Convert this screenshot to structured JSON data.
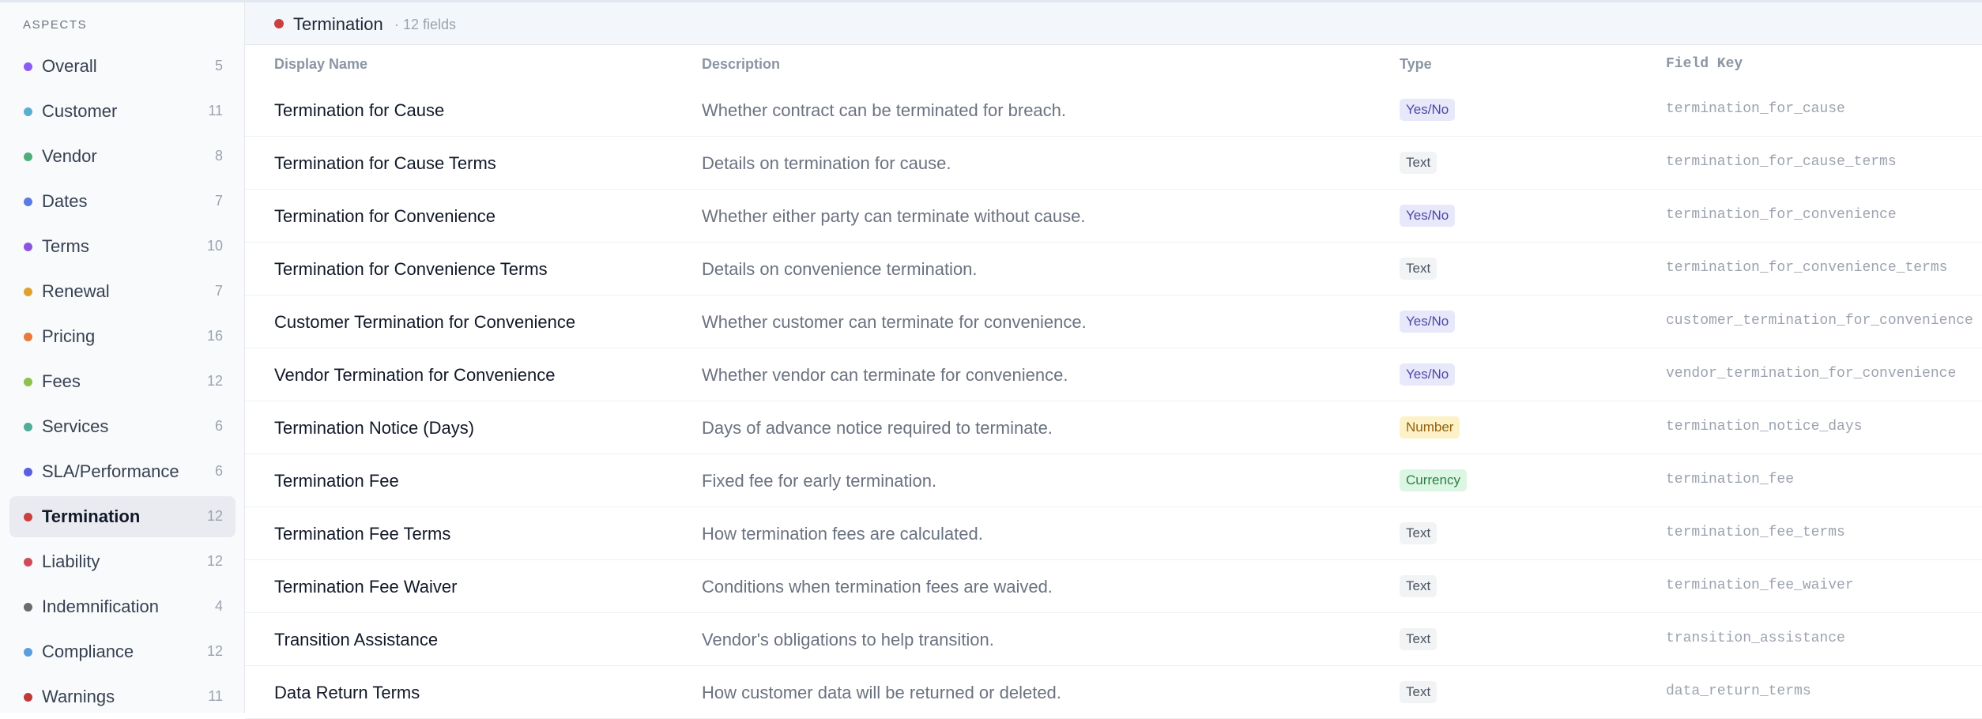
{
  "sidebar": {
    "title": "ASPECTS",
    "items": [
      {
        "label": "Overall",
        "count": "5",
        "color": "#8b5cf6"
      },
      {
        "label": "Customer",
        "count": "11",
        "color": "#5aaed0"
      },
      {
        "label": "Vendor",
        "count": "8",
        "color": "#4fae7a"
      },
      {
        "label": "Dates",
        "count": "7",
        "color": "#5b7be0"
      },
      {
        "label": "Terms",
        "count": "10",
        "color": "#8b55e0"
      },
      {
        "label": "Renewal",
        "count": "7",
        "color": "#e0a030"
      },
      {
        "label": "Pricing",
        "count": "16",
        "color": "#e8793a"
      },
      {
        "label": "Fees",
        "count": "12",
        "color": "#8cc24a"
      },
      {
        "label": "Services",
        "count": "6",
        "color": "#4fae95"
      },
      {
        "label": "SLA/Performance",
        "count": "6",
        "color": "#5a5fe0"
      },
      {
        "label": "Termination",
        "count": "12",
        "color": "#cc3f3f",
        "active": true
      },
      {
        "label": "Liability",
        "count": "12",
        "color": "#d04a5a"
      },
      {
        "label": "Indemnification",
        "count": "4",
        "color": "#6b6b6b"
      },
      {
        "label": "Compliance",
        "count": "12",
        "color": "#5a9ee0"
      },
      {
        "label": "Warnings",
        "count": "11",
        "color": "#c03a3a"
      }
    ]
  },
  "section": {
    "title": "Termination",
    "subtitle": "· 12 fields",
    "color": "#cc3f3f"
  },
  "table": {
    "headers": {
      "display_name": "Display Name",
      "description": "Description",
      "type": "Type",
      "field_key": "Field Key"
    },
    "rows": [
      {
        "name": "Termination for Cause",
        "desc": "Whether contract can be terminated for breach.",
        "type": "Yes/No",
        "kind": "yesno",
        "key": "termination_for_cause"
      },
      {
        "name": "Termination for Cause Terms",
        "desc": "Details on termination for cause.",
        "type": "Text",
        "kind": "text",
        "key": "termination_for_cause_terms"
      },
      {
        "name": "Termination for Convenience",
        "desc": "Whether either party can terminate without cause.",
        "type": "Yes/No",
        "kind": "yesno",
        "key": "termination_for_convenience"
      },
      {
        "name": "Termination for Convenience Terms",
        "desc": "Details on convenience termination.",
        "type": "Text",
        "kind": "text",
        "key": "termination_for_convenience_terms"
      },
      {
        "name": "Customer Termination for Convenience",
        "desc": "Whether customer can terminate for convenience.",
        "type": "Yes/No",
        "kind": "yesno",
        "key": "customer_termination_for_convenience"
      },
      {
        "name": "Vendor Termination for Convenience",
        "desc": "Whether vendor can terminate for convenience.",
        "type": "Yes/No",
        "kind": "yesno",
        "key": "vendor_termination_for_convenience"
      },
      {
        "name": "Termination Notice (Days)",
        "desc": "Days of advance notice required to terminate.",
        "type": "Number",
        "kind": "number",
        "key": "termination_notice_days"
      },
      {
        "name": "Termination Fee",
        "desc": "Fixed fee for early termination.",
        "type": "Currency",
        "kind": "currency",
        "key": "termination_fee"
      },
      {
        "name": "Termination Fee Terms",
        "desc": "How termination fees are calculated.",
        "type": "Text",
        "kind": "text",
        "key": "termination_fee_terms"
      },
      {
        "name": "Termination Fee Waiver",
        "desc": "Conditions when termination fees are waived.",
        "type": "Text",
        "kind": "text",
        "key": "termination_fee_waiver"
      },
      {
        "name": "Transition Assistance",
        "desc": "Vendor's obligations to help transition.",
        "type": "Text",
        "kind": "text",
        "key": "transition_assistance"
      },
      {
        "name": "Data Return Terms",
        "desc": "How customer data will be returned or deleted.",
        "type": "Text",
        "kind": "text",
        "key": "data_return_terms"
      }
    ]
  }
}
